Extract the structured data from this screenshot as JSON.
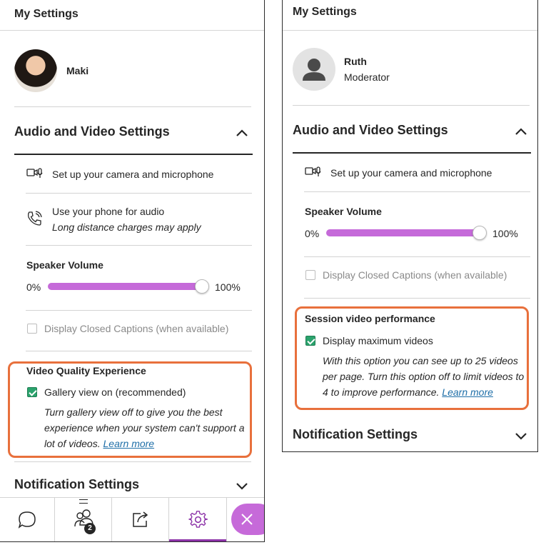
{
  "left_panel": {
    "title": "My Settings",
    "user": {
      "name": "Maki"
    },
    "audio_video": {
      "title": "Audio and Video Settings",
      "setup_label": "Set up your camera and microphone",
      "phone_label": "Use your phone for audio",
      "phone_sub": "Long distance charges may apply",
      "speaker_volume_label": "Speaker Volume",
      "volume_min": "0%",
      "volume_max": "100%",
      "volume_level": 1.0,
      "closed_captions_label": "Display Closed Captions (when available)"
    },
    "video_quality": {
      "title": "Video Quality Experience",
      "option_label": "Gallery view on (recommended)",
      "option_checked": true,
      "description": "Turn gallery view off to give you the best experience when your system can't support a lot of videos.",
      "learn_more": "Learn more"
    },
    "notification_title": "Notification Settings",
    "bottom_bar": {
      "participants_badge": "2",
      "active_tab": "settings",
      "accent_color": "#8c32a8"
    }
  },
  "right_panel": {
    "title": "My Settings",
    "user": {
      "name": "Ruth",
      "role": "Moderator"
    },
    "audio_video": {
      "title": "Audio and Video Settings",
      "setup_label": "Set up your camera and microphone",
      "speaker_volume_label": "Speaker Volume",
      "volume_min": "0%",
      "volume_max": "100%",
      "volume_level": 1.0,
      "closed_captions_label": "Display Closed Captions (when available)"
    },
    "session_video": {
      "title": "Session video performance",
      "option_label": "Display maximum videos",
      "option_checked": true,
      "description": "With this option you can see up to 25 videos per page. Turn this option off to limit videos to 4 to improve performance.",
      "learn_more": "Learn more"
    },
    "notification_title": "Notification Settings"
  },
  "colors": {
    "highlight": "#e8703c",
    "slider": "#c56ad9",
    "checkbox": "#2ba36d",
    "link": "#1f6fa8"
  }
}
